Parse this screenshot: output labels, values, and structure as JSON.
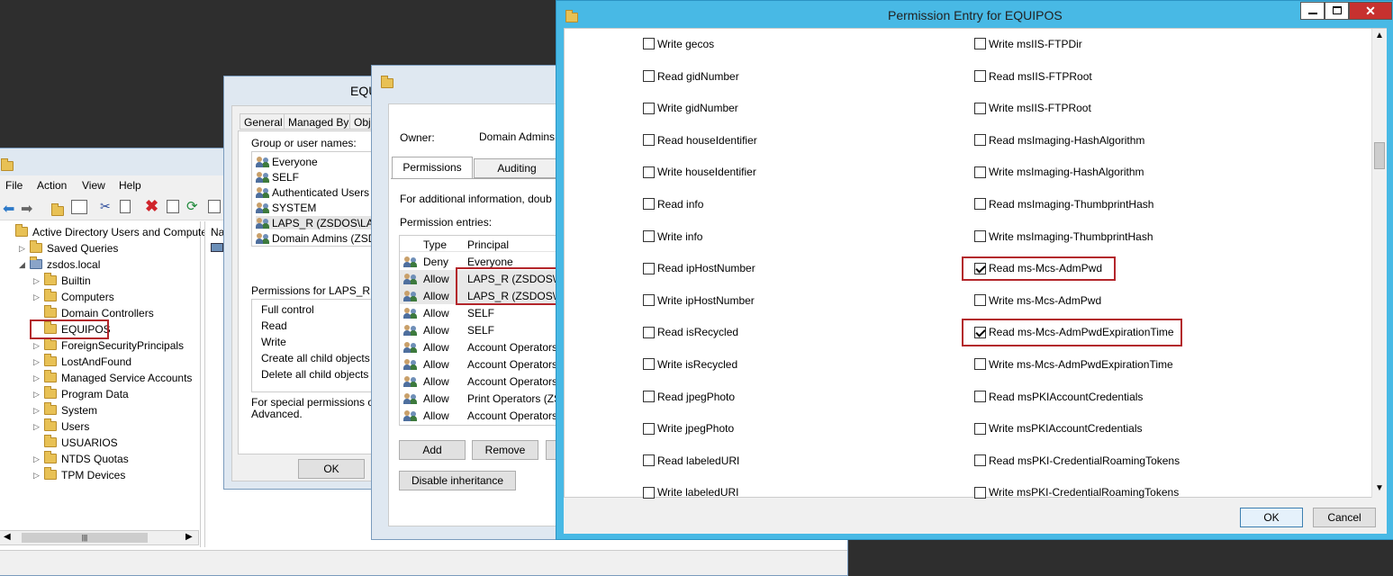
{
  "aduc": {
    "menu": [
      "File",
      "Action",
      "View",
      "Help"
    ],
    "tree": [
      {
        "label": "Active Directory Users and Computers",
        "indent": 0,
        "icon": "aduc",
        "exp": ""
      },
      {
        "label": "Saved Queries",
        "indent": 1,
        "icon": "folder",
        "exp": "▷"
      },
      {
        "label": "zsdos.local",
        "indent": 1,
        "icon": "domain",
        "exp": "◢"
      },
      {
        "label": "Builtin",
        "indent": 2,
        "icon": "folder",
        "exp": "▷"
      },
      {
        "label": "Computers",
        "indent": 2,
        "icon": "folder",
        "exp": "▷"
      },
      {
        "label": "Domain Controllers",
        "indent": 2,
        "icon": "folder",
        "exp": ""
      },
      {
        "label": "EQUIPOS",
        "indent": 2,
        "icon": "ou",
        "exp": ""
      },
      {
        "label": "ForeignSecurityPrincipals",
        "indent": 2,
        "icon": "folder",
        "exp": "▷"
      },
      {
        "label": "LostAndFound",
        "indent": 2,
        "icon": "folder",
        "exp": "▷"
      },
      {
        "label": "Managed Service Accounts",
        "indent": 2,
        "icon": "folder",
        "exp": "▷"
      },
      {
        "label": "Program Data",
        "indent": 2,
        "icon": "folder",
        "exp": "▷"
      },
      {
        "label": "System",
        "indent": 2,
        "icon": "folder",
        "exp": "▷"
      },
      {
        "label": "Users",
        "indent": 2,
        "icon": "folder",
        "exp": "▷"
      },
      {
        "label": "USUARIOS",
        "indent": 2,
        "icon": "ou",
        "exp": ""
      },
      {
        "label": "NTDS Quotas",
        "indent": 2,
        "icon": "folder",
        "exp": "▷"
      },
      {
        "label": "TPM Devices",
        "indent": 2,
        "icon": "folder",
        "exp": "▷"
      }
    ],
    "right_header": "Na"
  },
  "props": {
    "title": "EQUI",
    "tabs": [
      "General",
      "Managed By",
      "Obje"
    ],
    "group_label": "Group or user names:",
    "groups": [
      "Everyone",
      "SELF",
      "Authenticated Users",
      "SYSTEM",
      "LAPS_R (ZSDOS\\LAPS",
      "Domain Admins (ZSDOS"
    ],
    "perm_for_label": "Permissions for LAPS_R",
    "perms": [
      "Full control",
      "Read",
      "Write",
      "Create all child objects",
      "Delete all child objects"
    ],
    "special_text": "For special permissions or ad",
    "special_text2": "Advanced.",
    "ok": "OK"
  },
  "adv": {
    "owner_label": "Owner:",
    "owner_value": "Domain Admins",
    "tabs": [
      "Permissions",
      "Auditing"
    ],
    "info_text": "For additional information, doub",
    "entries_label": "Permission entries:",
    "col_type": "Type",
    "col_principal": "Principal",
    "entries": [
      {
        "type": "Deny",
        "principal": "Everyone"
      },
      {
        "type": "Allow",
        "principal": "LAPS_R (ZSDOS\\LA"
      },
      {
        "type": "Allow",
        "principal": "LAPS_R (ZSDOS\\LA"
      },
      {
        "type": "Allow",
        "principal": "SELF"
      },
      {
        "type": "Allow",
        "principal": "SELF"
      },
      {
        "type": "Allow",
        "principal": "Account Operators"
      },
      {
        "type": "Allow",
        "principal": "Account Operators"
      },
      {
        "type": "Allow",
        "principal": "Account Operators"
      },
      {
        "type": "Allow",
        "principal": "Print Operators (ZS"
      },
      {
        "type": "Allow",
        "principal": "Account Operators"
      }
    ],
    "add": "Add",
    "remove": "Remove",
    "disable_inheritance": "Disable inheritance"
  },
  "pe": {
    "title": "Permission Entry for EQUIPOS",
    "left": [
      {
        "label": "Write gecos",
        "checked": false
      },
      {
        "label": "Read gidNumber",
        "checked": false
      },
      {
        "label": "Write gidNumber",
        "checked": false
      },
      {
        "label": "Read houseIdentifier",
        "checked": false
      },
      {
        "label": "Write houseIdentifier",
        "checked": false
      },
      {
        "label": "Read info",
        "checked": false
      },
      {
        "label": "Write info",
        "checked": false
      },
      {
        "label": "Read ipHostNumber",
        "checked": false
      },
      {
        "label": "Write ipHostNumber",
        "checked": false
      },
      {
        "label": "Read isRecycled",
        "checked": false
      },
      {
        "label": "Write isRecycled",
        "checked": false
      },
      {
        "label": "Read jpegPhoto",
        "checked": false
      },
      {
        "label": "Write jpegPhoto",
        "checked": false
      },
      {
        "label": "Read labeledURI",
        "checked": false
      },
      {
        "label": "Write labeledURI",
        "checked": false
      }
    ],
    "right": [
      {
        "label": "Write msIIS-FTPDir",
        "checked": false
      },
      {
        "label": "Read msIIS-FTPRoot",
        "checked": false
      },
      {
        "label": "Write msIIS-FTPRoot",
        "checked": false
      },
      {
        "label": "Read msImaging-HashAlgorithm",
        "checked": false
      },
      {
        "label": "Write msImaging-HashAlgorithm",
        "checked": false
      },
      {
        "label": "Read msImaging-ThumbprintHash",
        "checked": false
      },
      {
        "label": "Write msImaging-ThumbprintHash",
        "checked": false
      },
      {
        "label": "Read ms-Mcs-AdmPwd",
        "checked": true
      },
      {
        "label": "Write ms-Mcs-AdmPwd",
        "checked": false
      },
      {
        "label": "Read ms-Mcs-AdmPwdExpirationTime",
        "checked": true
      },
      {
        "label": "Write ms-Mcs-AdmPwdExpirationTime",
        "checked": false
      },
      {
        "label": "Read msPKIAccountCredentials",
        "checked": false
      },
      {
        "label": "Write msPKIAccountCredentials",
        "checked": false
      },
      {
        "label": "Read msPKI-CredentialRoamingTokens",
        "checked": false
      },
      {
        "label": "Write msPKI-CredentialRoamingTokens",
        "checked": false
      }
    ],
    "ok": "OK",
    "cancel": "Cancel"
  }
}
